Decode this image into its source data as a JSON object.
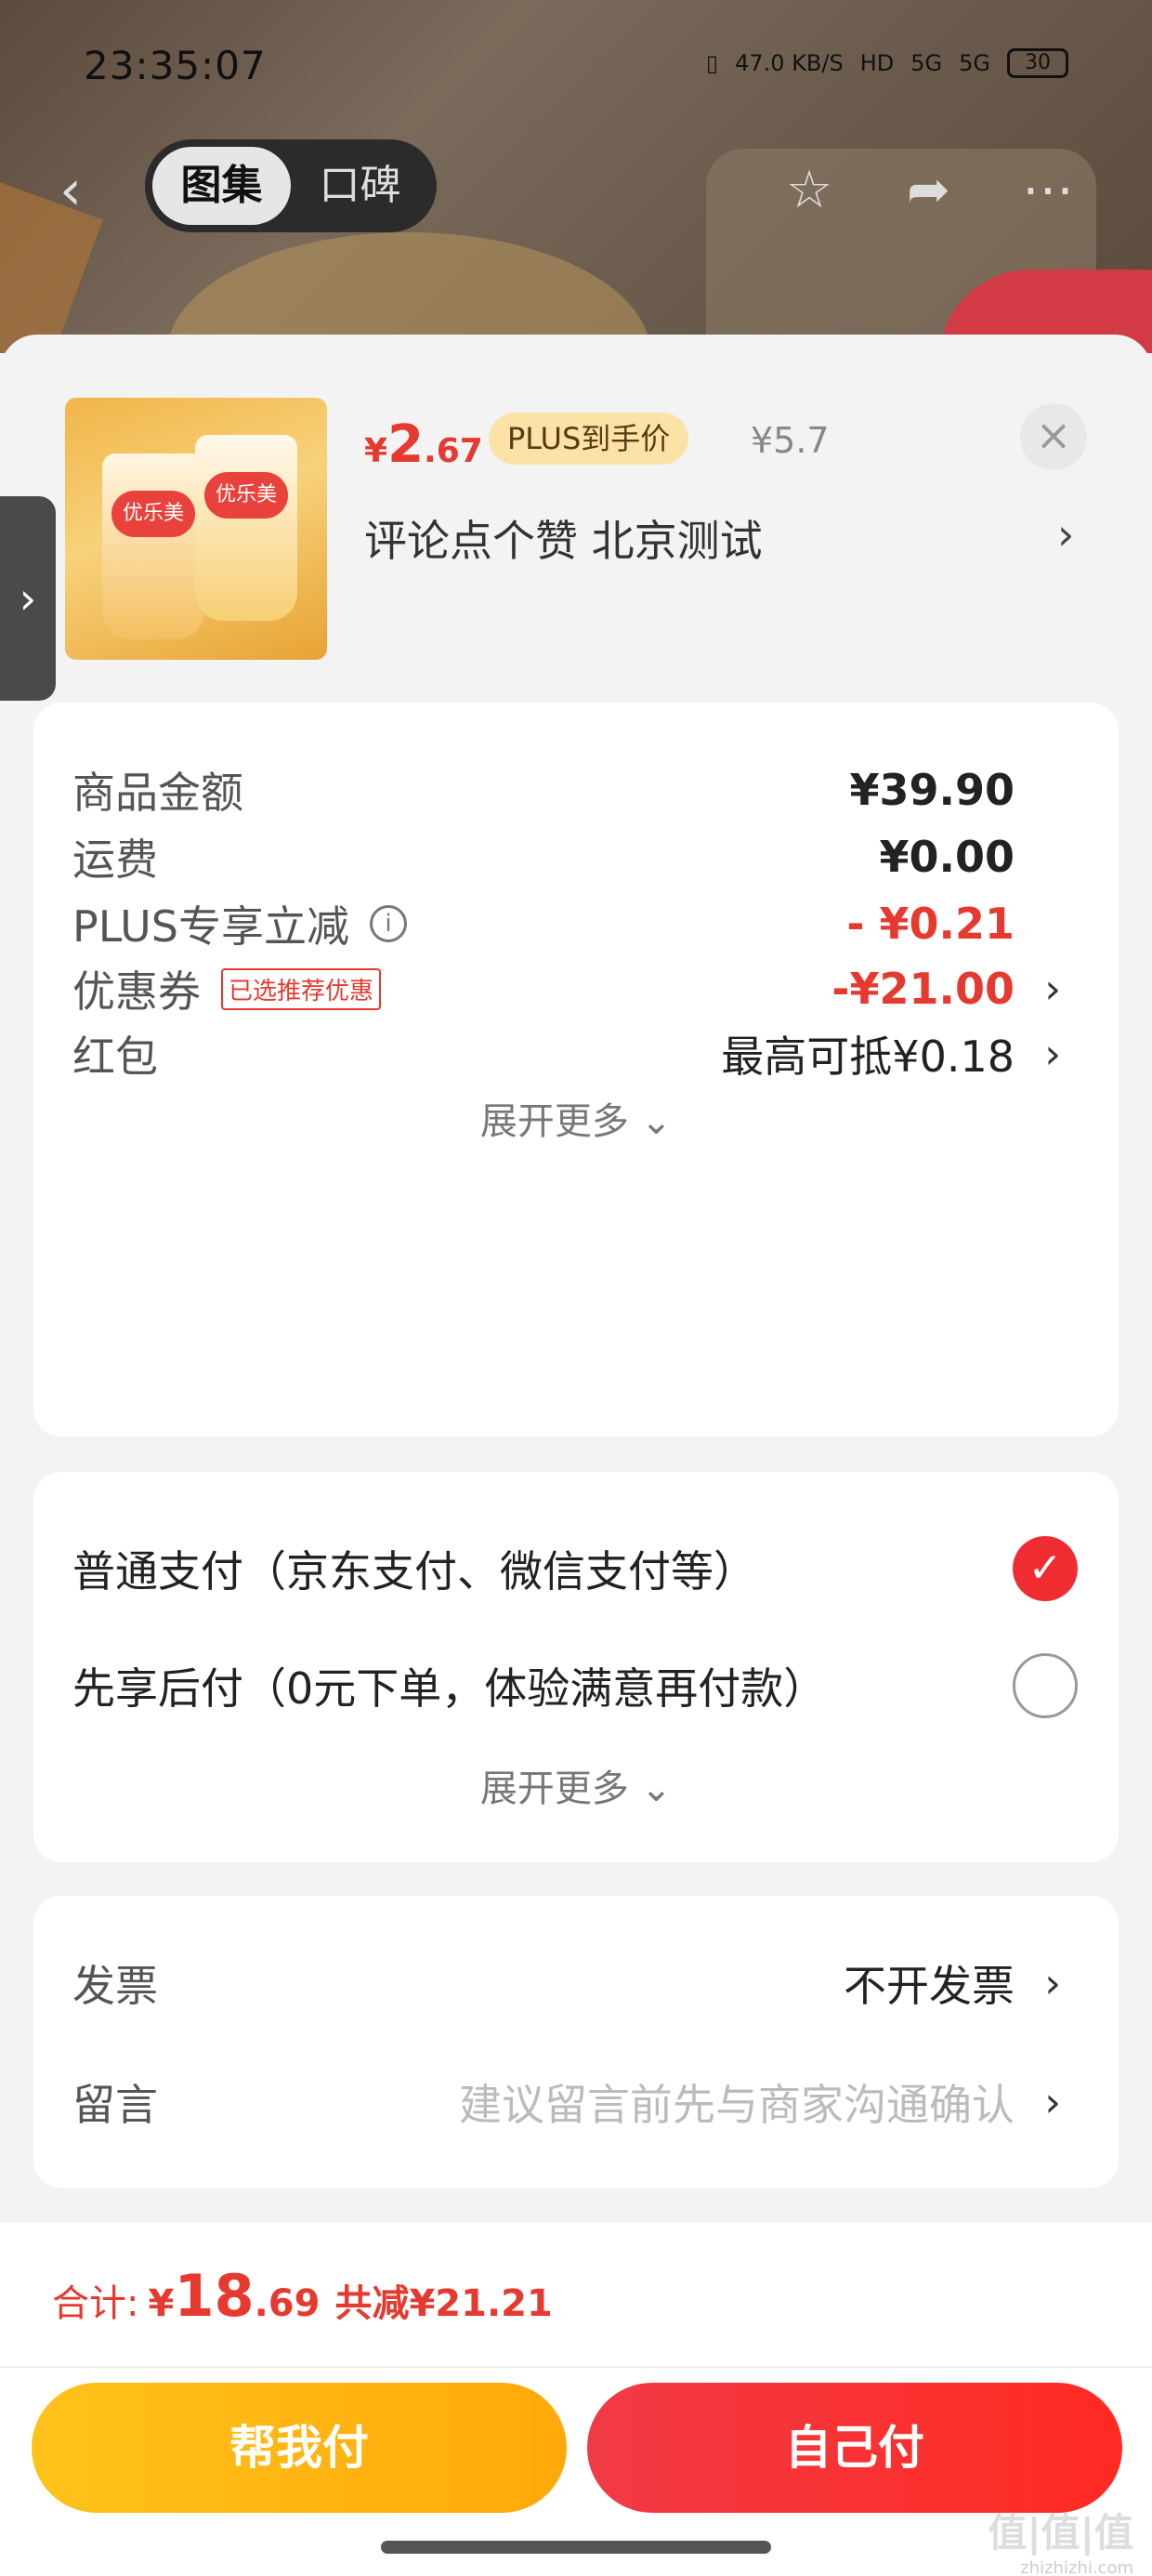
{
  "status_bar": {
    "time": "23:35:07",
    "net_speed": "47.0 KB/S",
    "hd": "HD",
    "signal1": "5G",
    "signal2": "5G",
    "battery": "30"
  },
  "nav": {
    "tab_gallery": "图集",
    "tab_reviews": "口碑"
  },
  "product": {
    "currency": "¥",
    "price_int": "2",
    "price_dec": ".67",
    "plus_badge": "PLUS到手价",
    "original_price": "¥5.7",
    "name": "评论点个赞  北京测试",
    "cup_label": "优乐美"
  },
  "costs": {
    "goods_label": "商品金额",
    "goods_value": "¥39.90",
    "shipping_label": "运费",
    "shipping_value": "¥0.00",
    "plus_label": "PLUS专享立减",
    "plus_value": "- ¥0.21",
    "coupon_label": "优惠券",
    "coupon_tag": "已选推荐优惠",
    "coupon_value": "-¥21.00",
    "redpacket_label": "红包",
    "redpacket_value": "最高可抵¥0.18",
    "expand": "展开更多"
  },
  "payment": {
    "normal": "普通支付（京东支付、微信支付等）",
    "later": "先享后付（0元下单，体验满意再付款）",
    "expand": "展开更多"
  },
  "extra": {
    "invoice_label": "发票",
    "invoice_value": "不开发票",
    "message_label": "留言",
    "message_placeholder": "建议留言前先与商家沟通确认"
  },
  "footer": {
    "total_label": "合计:",
    "total_currency": "¥",
    "total_int": "18",
    "total_dec": ".69",
    "saving": "共减¥21.21",
    "help_pay": "帮我付",
    "self_pay": "自己付"
  },
  "watermark": {
    "main": "值|值|值",
    "sub": "zhizhizhi.com"
  },
  "colors": {
    "accent_red": "#e6392f",
    "button_yellow": "#ffb414",
    "button_red": "#f02c33"
  }
}
